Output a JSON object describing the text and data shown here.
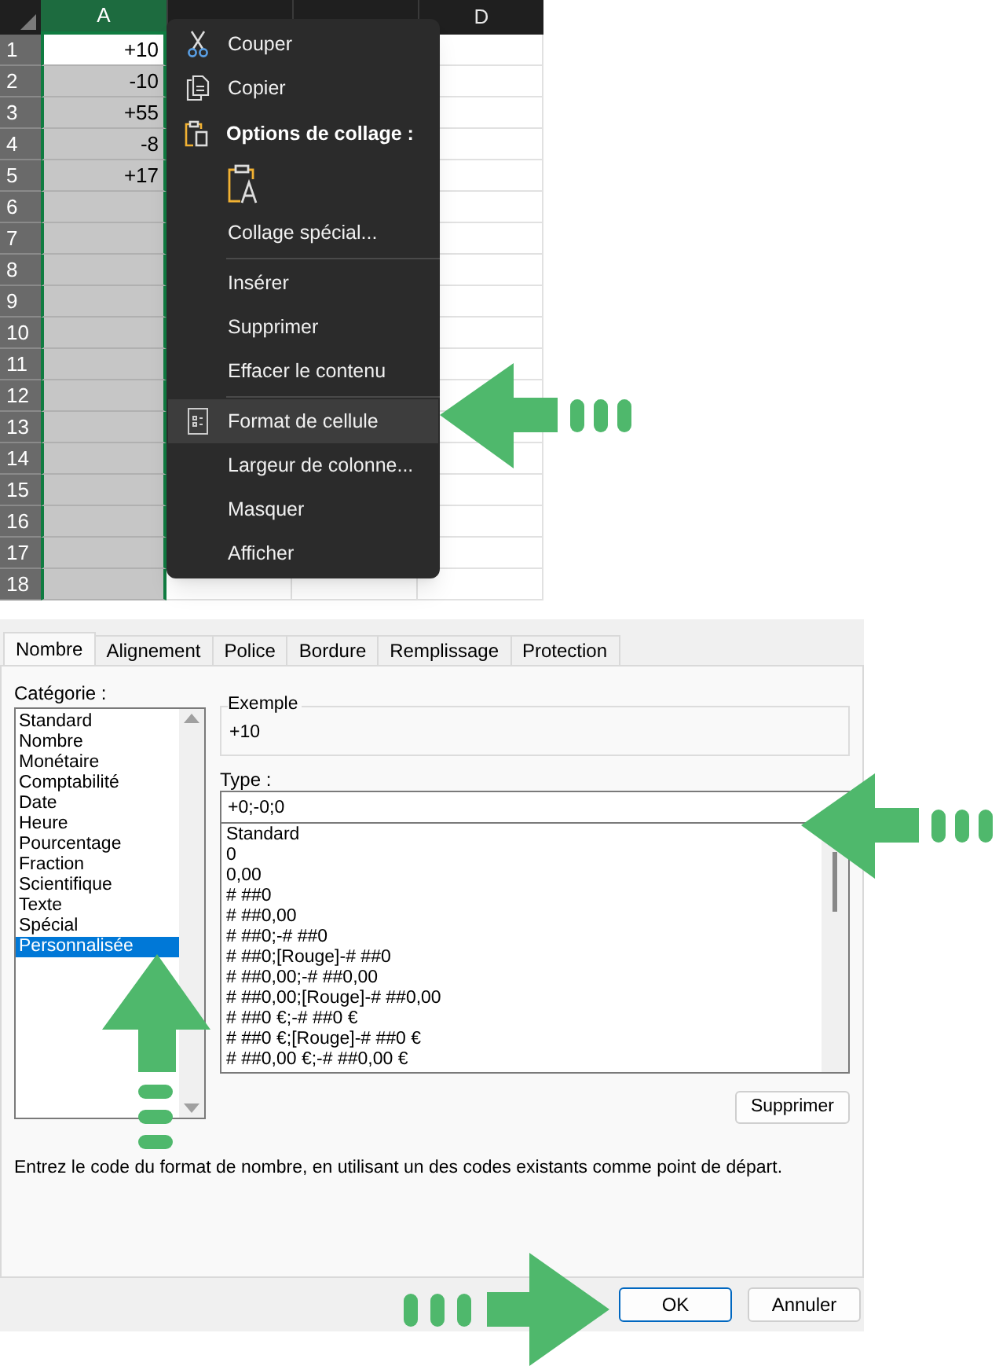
{
  "spreadsheet": {
    "columns": [
      {
        "label": "A",
        "selected": true
      },
      {
        "selected": false
      },
      {
        "selected": false
      },
      {
        "label": "D",
        "selected": false
      }
    ],
    "rows": [
      {
        "number": "1",
        "value": "+10",
        "active": true
      },
      {
        "number": "2",
        "value": "-10",
        "active": false
      },
      {
        "number": "3",
        "value": "+55",
        "active": false
      },
      {
        "number": "4",
        "value": "-8",
        "active": false
      },
      {
        "number": "5",
        "value": "+17",
        "active": false
      },
      {
        "number": "6",
        "active": false
      },
      {
        "number": "7",
        "active": false
      },
      {
        "number": "8",
        "active": false
      },
      {
        "number": "9",
        "active": false
      },
      {
        "number": "10",
        "active": false
      },
      {
        "number": "11",
        "active": false
      },
      {
        "number": "12",
        "active": false
      },
      {
        "number": "13",
        "active": false
      },
      {
        "number": "14",
        "active": false
      },
      {
        "number": "15",
        "active": false
      },
      {
        "number": "16",
        "active": false
      },
      {
        "number": "17",
        "active": false
      },
      {
        "number": "18",
        "active": false
      }
    ]
  },
  "context_menu": {
    "items": [
      {
        "kind": "command",
        "label": "Couper",
        "highlighted": false
      },
      {
        "kind": "command",
        "label": "Copier",
        "highlighted": false
      },
      {
        "kind": "heading",
        "label": "Options de collage :"
      },
      {
        "kind": "paste-options"
      },
      {
        "kind": "command",
        "label": "Collage spécial...",
        "highlighted": false
      },
      {
        "kind": "separator"
      },
      {
        "kind": "command",
        "label": "Insérer",
        "highlighted": false
      },
      {
        "kind": "command",
        "label": "Supprimer",
        "highlighted": false
      },
      {
        "kind": "command",
        "label": "Effacer le contenu",
        "highlighted": false
      },
      {
        "kind": "separator"
      },
      {
        "kind": "command",
        "label": "Format de cellule",
        "highlighted": true
      },
      {
        "kind": "command",
        "label": "Largeur de colonne...",
        "highlighted": false
      },
      {
        "kind": "command",
        "label": "Masquer",
        "highlighted": false
      },
      {
        "kind": "command",
        "label": "Afficher",
        "highlighted": false
      }
    ]
  },
  "dialog": {
    "tabs": [
      {
        "label": "Nombre",
        "selected": true
      },
      {
        "label": "Alignement",
        "selected": false
      },
      {
        "label": "Police",
        "selected": false
      },
      {
        "label": "Bordure",
        "selected": false
      },
      {
        "label": "Remplissage",
        "selected": false
      },
      {
        "label": "Protection",
        "selected": false
      }
    ],
    "category_label": "Catégorie :",
    "categories": [
      {
        "label": "Standard",
        "selected": false
      },
      {
        "label": "Nombre",
        "selected": false
      },
      {
        "label": "Monétaire",
        "selected": false
      },
      {
        "label": "Comptabilité",
        "selected": false
      },
      {
        "label": "Date",
        "selected": false
      },
      {
        "label": "Heure",
        "selected": false
      },
      {
        "label": "Pourcentage",
        "selected": false
      },
      {
        "label": "Fraction",
        "selected": false
      },
      {
        "label": "Scientifique",
        "selected": false
      },
      {
        "label": "Texte",
        "selected": false
      },
      {
        "label": "Spécial",
        "selected": false
      },
      {
        "label": "Personnalisée",
        "selected": true
      }
    ],
    "example": {
      "title": "Exemple",
      "value": "+10"
    },
    "type_label": "Type :",
    "type_value": "+0;-0;0",
    "type_list": [
      "Standard",
      "0",
      "0,00",
      "# ##0",
      "# ##0,00",
      "# ##0;-# ##0",
      "# ##0;[Rouge]-# ##0",
      "# ##0,00;-# ##0,00",
      "# ##0,00;[Rouge]-# ##0,00",
      "# ##0 €;-# ##0 €",
      "# ##0 €;[Rouge]-# ##0 €",
      "# ##0,00 €;-# ##0,00 €"
    ],
    "delete_button": "Supprimer",
    "description": "Entrez le code du format de nombre, en utilisant un des codes existants comme point de départ.",
    "buttons": [
      {
        "label": "OK",
        "default": true
      },
      {
        "label": "Annuler",
        "default": false
      }
    ]
  }
}
